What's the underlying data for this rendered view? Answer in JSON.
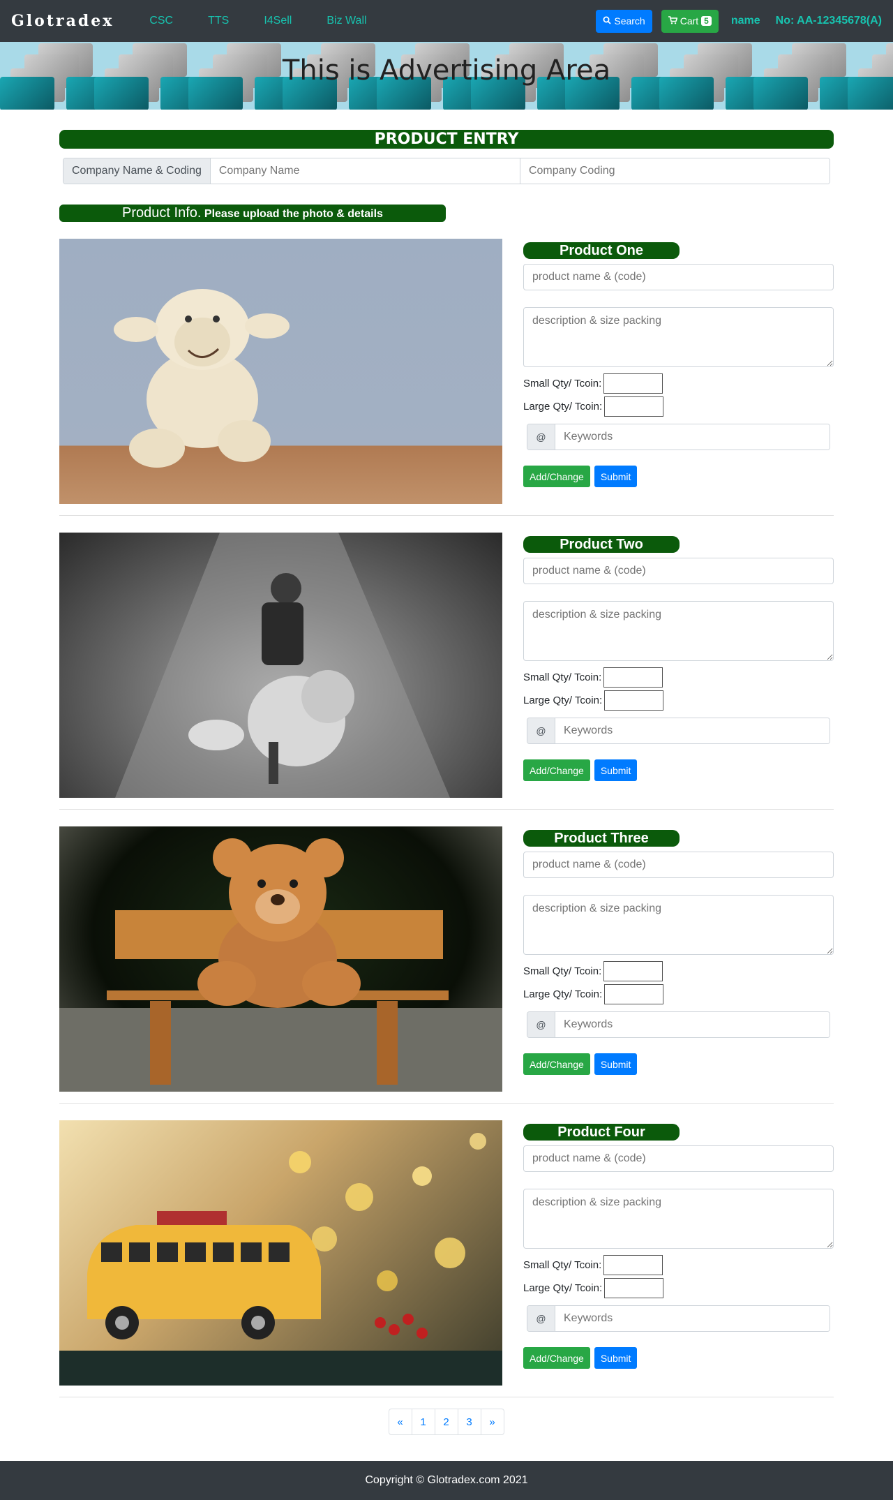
{
  "nav": {
    "brand": "Glotradex",
    "links": [
      "CSC",
      "TTS",
      "I4Sell",
      "Biz Wall"
    ],
    "search_label": "Search",
    "cart_label": "Cart",
    "cart_count": "5",
    "name": "name",
    "account_no": "No: AA-12345678(A)"
  },
  "ad": {
    "text": "This is Advertising Area"
  },
  "entry": {
    "title": "PRODUCT ENTRY",
    "company_addon": "Company Name & Coding",
    "company_name_placeholder": "Company Name",
    "company_coding_placeholder": "Company Coding"
  },
  "info": {
    "title": "Product Info.",
    "subtitle": "Please upload the photo & details"
  },
  "products": [
    {
      "title": "Product One",
      "name_placeholder": "product name & (code)",
      "desc_placeholder": "description & size packing",
      "small_label": "Small Qty/ Tcoin:",
      "large_label": "Large Qty/ Tcoin:",
      "kw_addon": "@",
      "kw_placeholder": "Keywords",
      "add_label": "Add/Change",
      "submit_label": "Submit"
    },
    {
      "title": "Product Two",
      "name_placeholder": "product name & (code)",
      "desc_placeholder": "description & size packing",
      "small_label": "Small Qty/ Tcoin:",
      "large_label": "Large Qty/ Tcoin:",
      "kw_addon": "@",
      "kw_placeholder": "Keywords",
      "add_label": "Add/Change",
      "submit_label": "Submit"
    },
    {
      "title": "Product Three",
      "name_placeholder": "product name & (code)",
      "desc_placeholder": "description & size packing",
      "small_label": "Small Qty/ Tcoin:",
      "large_label": "Large Qty/ Tcoin:",
      "kw_addon": "@",
      "kw_placeholder": "Keywords",
      "add_label": "Add/Change",
      "submit_label": "Submit"
    },
    {
      "title": "Product Four",
      "name_placeholder": "product name & (code)",
      "desc_placeholder": "description & size packing",
      "small_label": "Small Qty/ Tcoin:",
      "large_label": "Large Qty/ Tcoin:",
      "kw_addon": "@",
      "kw_placeholder": "Keywords",
      "add_label": "Add/Change",
      "submit_label": "Submit"
    }
  ],
  "pagination": [
    "«",
    "1",
    "2",
    "3",
    "»"
  ],
  "footer": {
    "text": "Copyright © Glotradex.com 2021"
  }
}
